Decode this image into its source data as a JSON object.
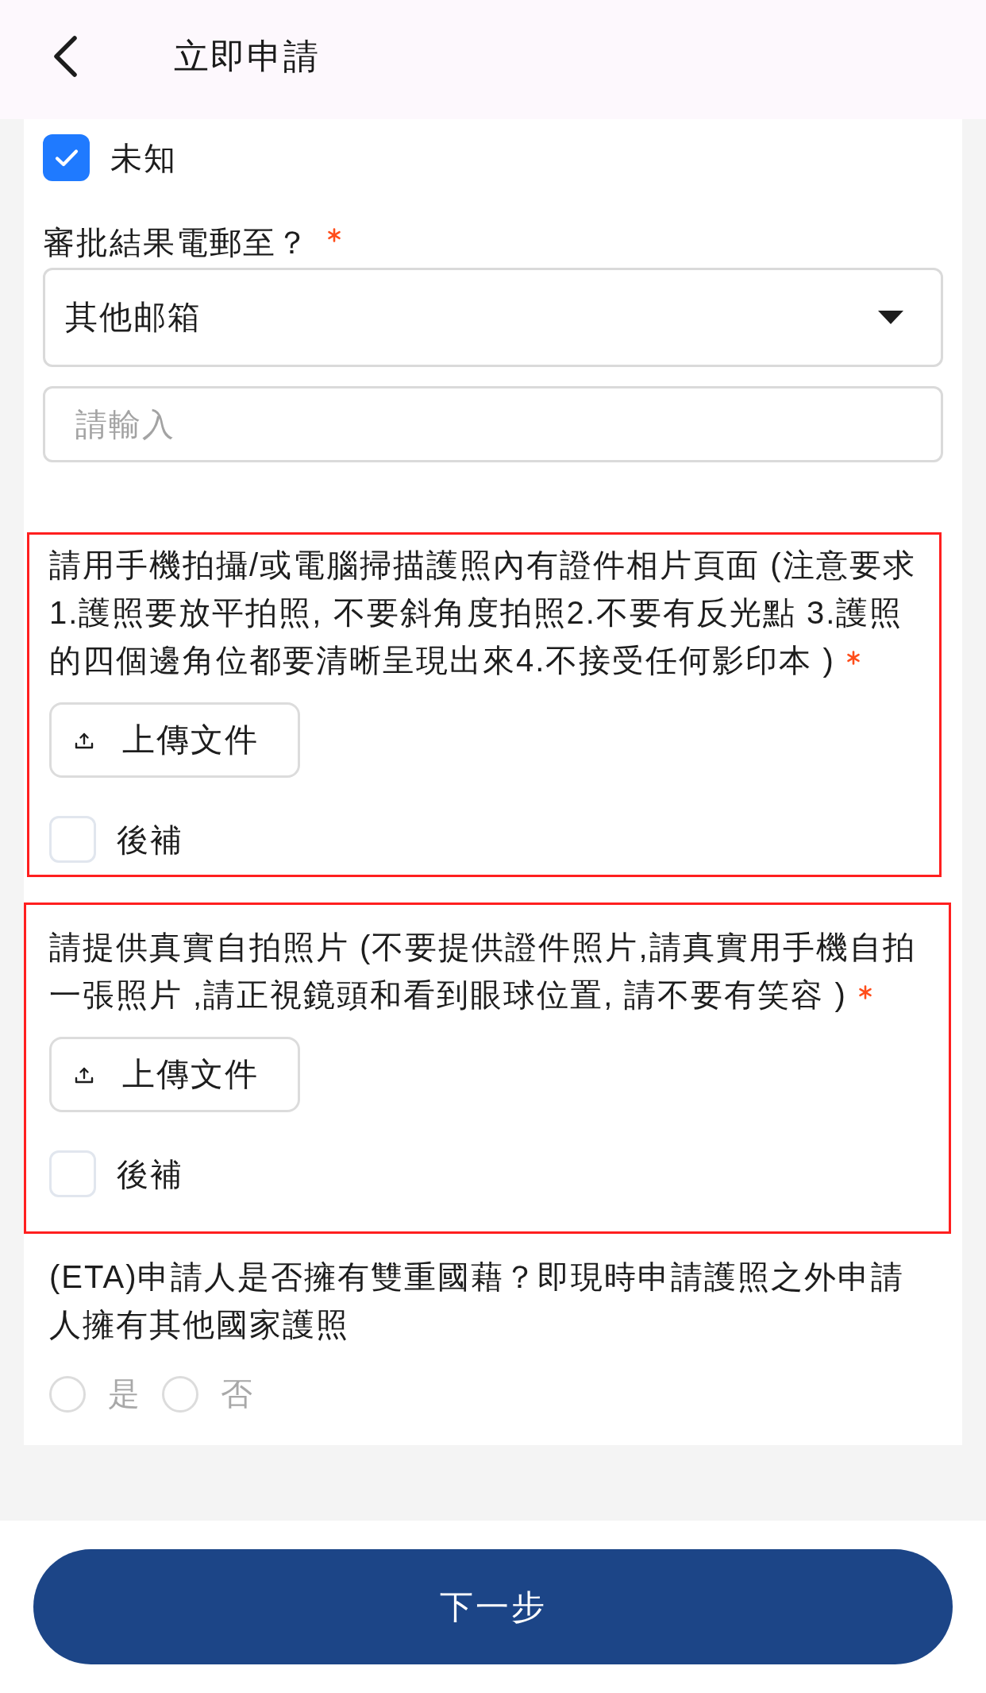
{
  "header": {
    "title": "立即申請"
  },
  "form": {
    "unknown_checkbox": {
      "label": "未知",
      "checked": true
    },
    "email_field": {
      "label": "審批結果電郵至？",
      "required": true,
      "select_value": "其他邮箱",
      "input_placeholder": "請輸入"
    },
    "upload_sections": [
      {
        "instruction": "請用手機拍攝/或電腦掃描護照內有證件相片頁面 (注意要求1.護照要放平拍照, 不要斜角度拍照2.不要有反光點 3.護照的四個邊角位都要清晰呈現出來4.不接受任何影印本 )",
        "required": true,
        "highlighted": true,
        "upload_button": "上傳文件",
        "later_checkbox": {
          "label": "後補",
          "checked": false
        }
      },
      {
        "instruction": "請提供真實自拍照片 (不要提供證件照片,請真實用手機自拍一張照片 ,請正視鏡頭和看到眼球位置, 請不要有笑容 )",
        "required": true,
        "highlighted": true,
        "upload_button": "上傳文件",
        "later_checkbox": {
          "label": "後補",
          "checked": false
        }
      }
    ],
    "dual_nationality": {
      "question": "(ETA)申請人是否擁有雙重國藉？即現時申請護照之外申請人擁有其他國家護照",
      "options": [
        {
          "label": "是",
          "selected": false
        },
        {
          "label": "否",
          "selected": false
        }
      ]
    }
  },
  "next_button": "下一步"
}
